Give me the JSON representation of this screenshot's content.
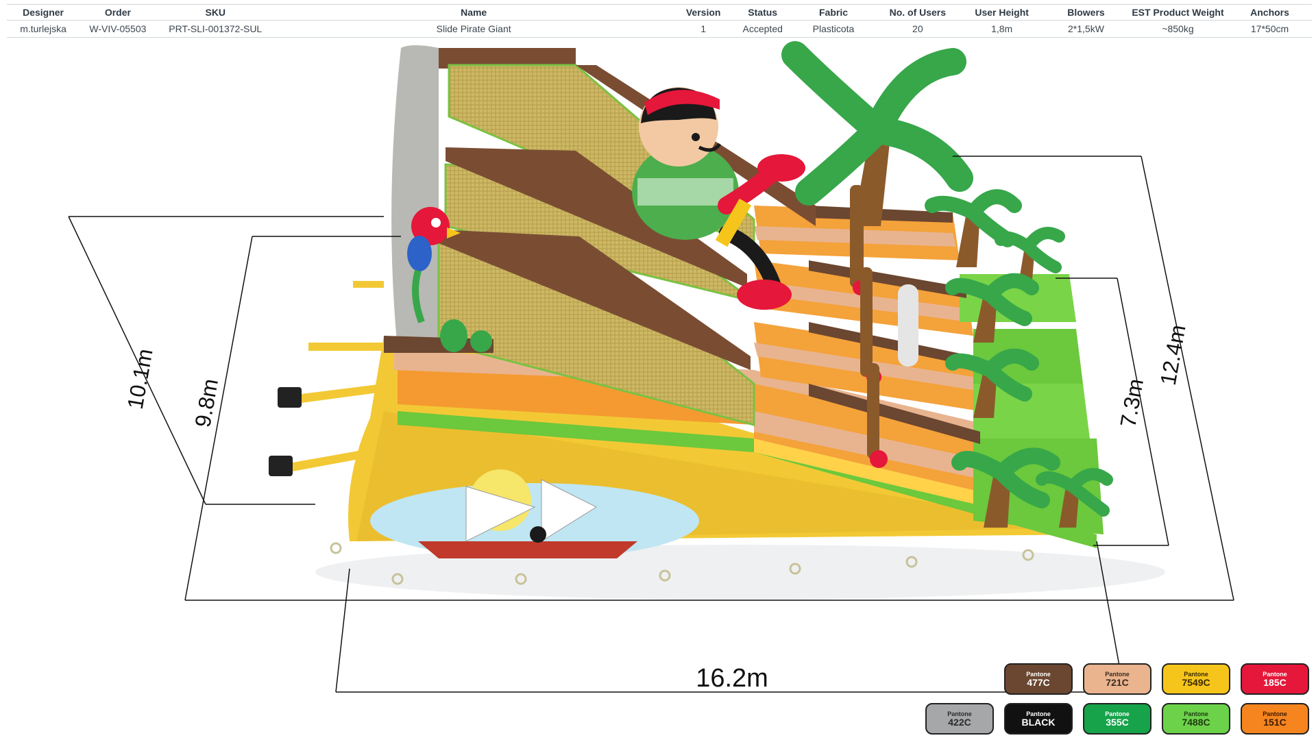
{
  "spec_table": {
    "headers": [
      "Designer",
      "Order",
      "SKU",
      "Name",
      "Version",
      "Status",
      "Fabric",
      "No. of Users",
      "User  Height",
      "Blowers",
      "EST Product Weight",
      "Anchors"
    ],
    "values": [
      "m.turlejska",
      "W-VIV-05503",
      "PRT-SLI-001372-SUL",
      "Slide Pirate Giant",
      "1",
      "Accepted",
      "Plasticota",
      "20",
      "1,8m",
      "2*1,5kW",
      "~850kg",
      "17*50cm"
    ]
  },
  "dimensions": {
    "d1": "10.1m",
    "d2": "9.8m",
    "d3": "7.3m",
    "d4": "12.4m",
    "d5": "16.2m"
  },
  "palette": [
    {
      "label": "Pantone",
      "code": "477C",
      "color": "#6b4630",
      "text": "#ffffff"
    },
    {
      "label": "Pantone",
      "code": "721C",
      "color": "#e9b48e",
      "text": "#3a2a20"
    },
    {
      "label": "Pantone",
      "code": "7549C",
      "color": "#f6c51c",
      "text": "#3a2a00"
    },
    {
      "label": "Pantone",
      "code": "185C",
      "color": "#e5173a",
      "text": "#ffffff"
    },
    {
      "label": "Pantone",
      "code": "422C",
      "color": "#a5a7a8",
      "text": "#2a2a2a"
    },
    {
      "label": "Pantone",
      "code": "BLACK",
      "color": "#111111",
      "text": "#ffffff"
    },
    {
      "label": "Pantone",
      "code": "355C",
      "color": "#16a34a",
      "text": "#ffffff"
    },
    {
      "label": "Pantone",
      "code": "7488C",
      "color": "#6cd24a",
      "text": "#1f3a10"
    },
    {
      "label": "Pantone",
      "code": "151C",
      "color": "#f6851f",
      "text": "#3a1a00"
    }
  ]
}
